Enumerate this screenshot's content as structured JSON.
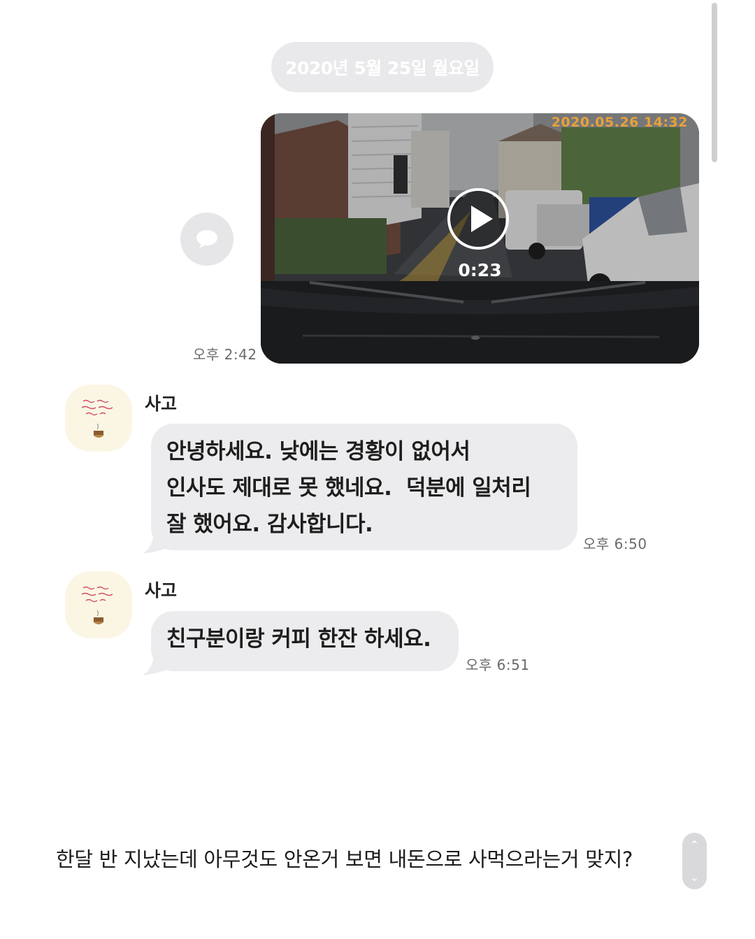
{
  "date_divider": "2020년 5월 25일 월요일",
  "video_message": {
    "overlay_timestamp": "2020.05.26 14:32",
    "duration": "0:23",
    "time": "오후 2:42"
  },
  "messages": [
    {
      "sender": "사고",
      "lines": [
        "안녕하세요. 낮에는 경황이 없어서",
        "인사도 제대로 못 했네요.  덕분에 일처리",
        "잘 했어요. 감사합니다."
      ],
      "time": "오후 6:50"
    },
    {
      "sender": "사고",
      "lines": [
        "친구분이랑 커피 한잔 하세요."
      ],
      "time": "오후 6:51"
    }
  ],
  "caption": "한달 반 지났는데 아무것도 안온거 보면 내돈으로 사먹으라는거 맞지?",
  "icons": {
    "share": "speech-bubble-icon",
    "play": "play-icon",
    "scroll_up": "chevron-up-icon",
    "scroll_down": "chevron-down-icon"
  },
  "colors": {
    "bubble": "#ececee",
    "date_pill": "#e9e9eb",
    "timestamp_overlay": "#e7a23a"
  }
}
